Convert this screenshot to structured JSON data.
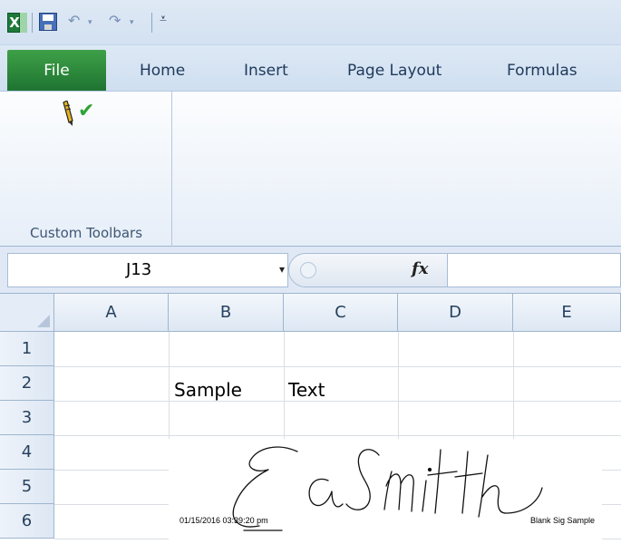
{
  "quick_access": {
    "app_icon_letter": "X",
    "icons": [
      "excel-icon",
      "save-icon",
      "undo-icon",
      "redo-icon",
      "customize-qat-icon"
    ],
    "undo_glyph": "↶",
    "redo_glyph": "↷",
    "dropdown_glyph": "▾",
    "customize_glyph": "⩡"
  },
  "ribbon": {
    "tabs": [
      {
        "label": "File"
      },
      {
        "label": "Home"
      },
      {
        "label": "Insert"
      },
      {
        "label": "Page Layout"
      },
      {
        "label": "Formulas"
      }
    ],
    "active_tab": "File",
    "group": {
      "label": "Custom Toolbars",
      "icons": [
        "pencil-icon",
        "check-icon"
      ],
      "check_glyph": "✔"
    }
  },
  "formula_bar": {
    "name_box": "J13",
    "dropdown_glyph": "▾",
    "fx_label": "fx",
    "formula_value": ""
  },
  "sheet": {
    "columns": [
      "A",
      "B",
      "C",
      "D",
      "E"
    ],
    "rows": [
      "1",
      "2",
      "3",
      "4",
      "5",
      "6"
    ],
    "cells": {
      "B2": "Sample",
      "C2": "Text"
    }
  },
  "signature": {
    "name_graphic": "Ed Smith",
    "timestamp": "01/15/2016 03:39:20 pm",
    "caption": "Blank Sig Sample"
  },
  "colors": {
    "file_tab": "#2a8a3c",
    "ribbon_bg": "#dfe9f5",
    "check": "#2fa336",
    "header_text": "#27415f"
  }
}
